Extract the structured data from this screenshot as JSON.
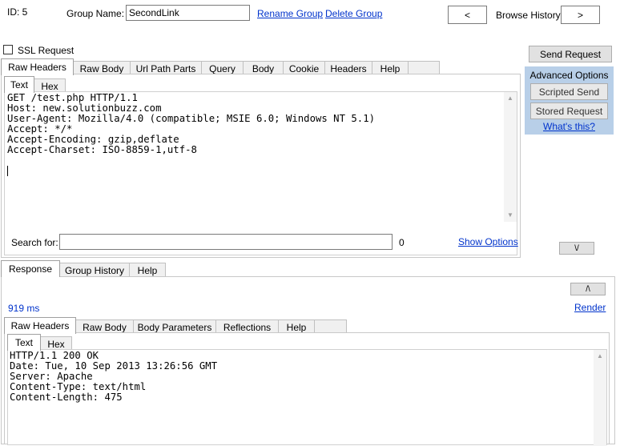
{
  "header": {
    "id_label": "ID: 5",
    "group_name_label": "Group Name:",
    "group_name_value": "SecondLink",
    "rename_group": "Rename Group",
    "delete_group": "Delete Group",
    "prev_label": "<",
    "browse_history": "Browse History",
    "next_label": ">"
  },
  "ssl_request": {
    "label": "SSL Request",
    "checked": false
  },
  "send_request": "Send Request",
  "advanced": {
    "title": "Advanced Options",
    "scripted_send": "Scripted Send",
    "stored_request": "Stored Request",
    "whats_this": "What's this?"
  },
  "request_tabs": [
    "Raw Headers",
    "Raw Body",
    "Url Path Parts",
    "Query",
    "Body",
    "Cookie",
    "Headers",
    "Help"
  ],
  "request_subtabs": [
    "Text",
    "Hex"
  ],
  "request_text": "GET /test.php HTTP/1.1\nHost: new.solutionbuzz.com\nUser-Agent: Mozilla/4.0 (compatible; MSIE 6.0; Windows NT 5.1)\nAccept: */*\nAccept-Encoding: gzip,deflate\nAccept-Charset: ISO-8859-1,utf-8",
  "search": {
    "label": "Search for:",
    "value": "",
    "count": "0",
    "show_options": "Show Options"
  },
  "collapse_down": "\\/",
  "response_tabs": [
    "Response",
    "Group History",
    "Help"
  ],
  "expand_up": "/\\",
  "response_time": "919 ms",
  "render": "Render",
  "response_inner_tabs": [
    "Raw Headers",
    "Raw Body",
    "Body Parameters",
    "Reflections",
    "Help"
  ],
  "response_subtabs": [
    "Text",
    "Hex"
  ],
  "response_text": "HTTP/1.1 200 OK\nDate: Tue, 10 Sep 2013 13:26:56 GMT\nServer: Apache\nContent-Type: text/html\nContent-Length: 475"
}
